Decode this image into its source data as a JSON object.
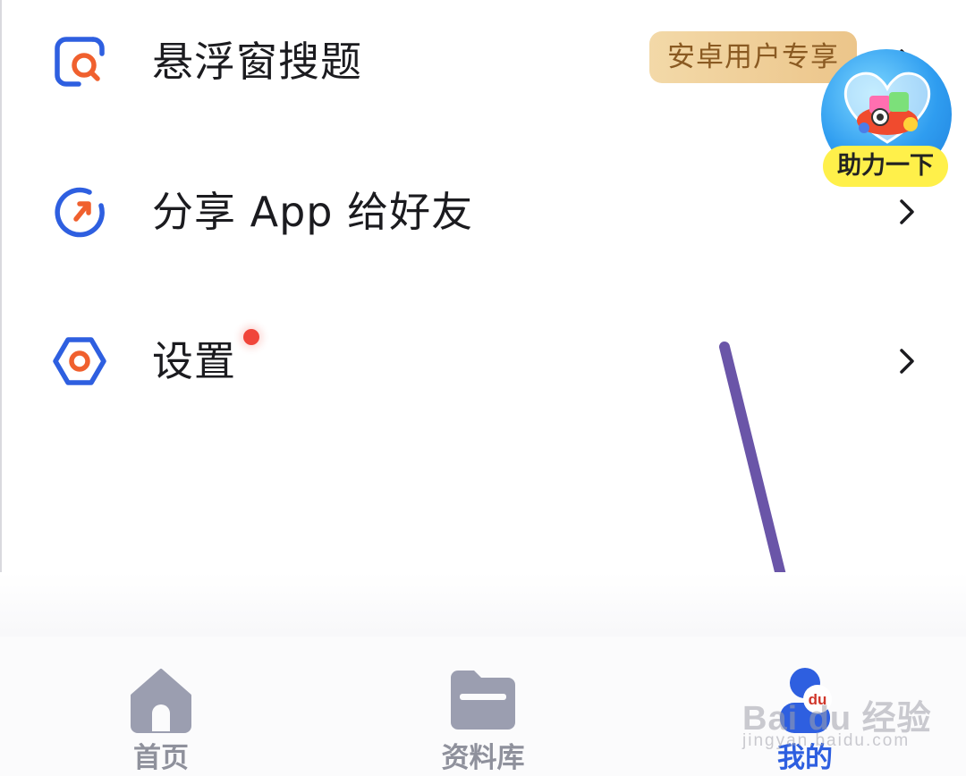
{
  "menu": {
    "items": [
      {
        "label": "悬浮窗搜题",
        "icon": "floating-search-icon",
        "badge": "安卓用户专享"
      },
      {
        "label": "分享 App 给好友",
        "icon": "share-refresh-icon"
      },
      {
        "label": "设置",
        "icon": "settings-hexagon-icon",
        "has_red_dot": true
      }
    ]
  },
  "floating_widget": {
    "label": "助力一下",
    "icon": "heart-gift-icon"
  },
  "bottom_nav": {
    "items": [
      {
        "label": "首页",
        "icon": "home-icon",
        "active": false
      },
      {
        "label": "资料库",
        "icon": "folder-icon",
        "active": false
      },
      {
        "label": "我的",
        "icon": "profile-du-icon",
        "active": true
      }
    ]
  },
  "watermark": {
    "logo": "Bai du 经验",
    "url": "jingyan.baidu.com"
  },
  "colors": {
    "accent_blue": "#2e5fe0",
    "accent_orange": "#f0602e",
    "badge_gold": "#ecc58a",
    "red_dot": "#f0453a",
    "annotation_arrow": "#6a55a8",
    "nav_inactive": "#9b9eb0"
  }
}
